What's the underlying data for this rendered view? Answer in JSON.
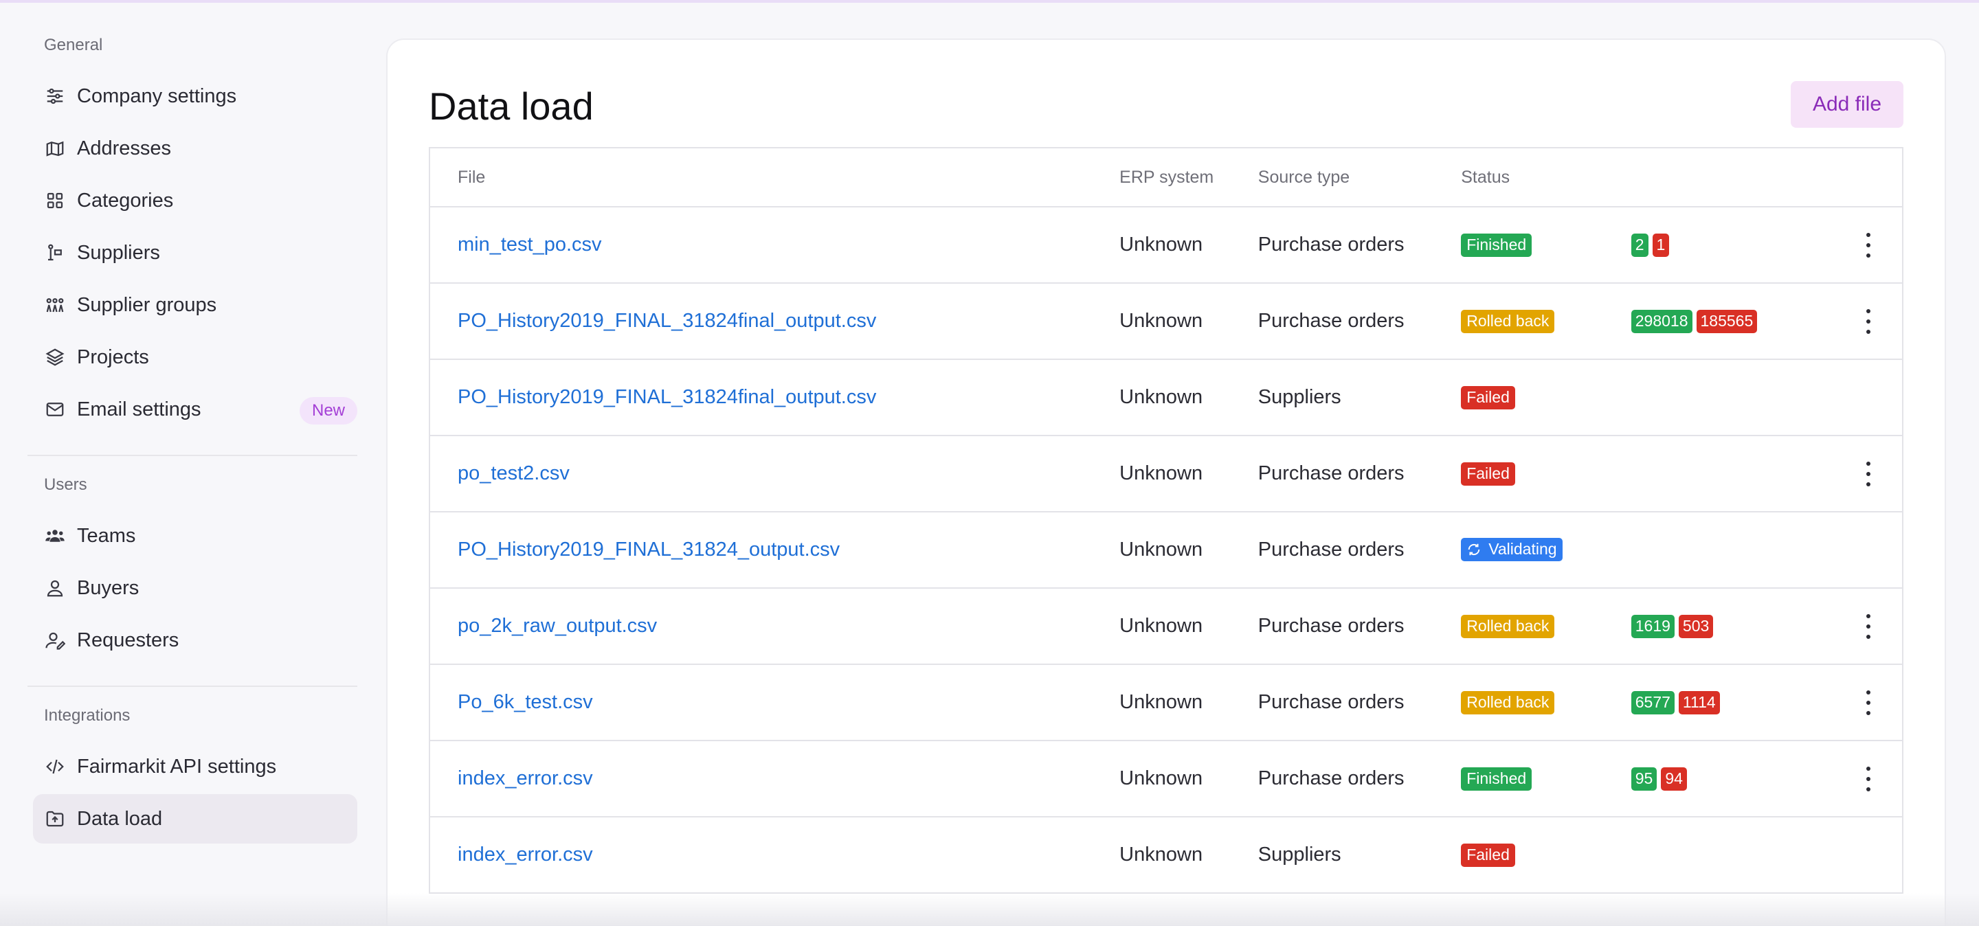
{
  "sidebar": {
    "sections": [
      {
        "title": "General",
        "items": [
          {
            "label": "Company settings",
            "icon": "sliders-icon"
          },
          {
            "label": "Addresses",
            "icon": "map-pin-icon"
          },
          {
            "label": "Categories",
            "icon": "grid-icon"
          },
          {
            "label": "Suppliers",
            "icon": "supplier-icon"
          },
          {
            "label": "Supplier groups",
            "icon": "group-icon"
          },
          {
            "label": "Projects",
            "icon": "layers-icon"
          },
          {
            "label": "Email settings",
            "icon": "mail-icon",
            "badge": "New"
          }
        ]
      },
      {
        "title": "Users",
        "items": [
          {
            "label": "Teams",
            "icon": "team-icon"
          },
          {
            "label": "Buyers",
            "icon": "user-icon"
          },
          {
            "label": "Requesters",
            "icon": "user-edit-icon"
          }
        ]
      },
      {
        "title": "Integrations",
        "items": [
          {
            "label": "Fairmarkit API settings",
            "icon": "code-icon"
          },
          {
            "label": "Data load",
            "icon": "upload-icon",
            "active": true
          }
        ]
      }
    ]
  },
  "main": {
    "title": "Data load",
    "add_file_label": "Add file",
    "columns": {
      "file": "File",
      "erp": "ERP system",
      "source": "Source type",
      "status": "Status"
    },
    "rows": [
      {
        "file": "min_test_po.csv",
        "erp": "Unknown",
        "source": "Purchase orders",
        "status": "Finished",
        "status_color": "green",
        "success": "2",
        "error": "1",
        "menu": true
      },
      {
        "file": "PO_History2019_FINAL_31824final_output.csv",
        "erp": "Unknown",
        "source": "Purchase orders",
        "status": "Rolled back",
        "status_color": "amber",
        "success": "298018",
        "error": "185565",
        "menu": true
      },
      {
        "file": "PO_History2019_FINAL_31824final_output.csv",
        "erp": "Unknown",
        "source": "Suppliers",
        "status": "Failed",
        "status_color": "red",
        "success": "",
        "error": "",
        "menu": false
      },
      {
        "file": "po_test2.csv",
        "erp": "Unknown",
        "source": "Purchase orders",
        "status": "Failed",
        "status_color": "red",
        "success": "",
        "error": "",
        "menu": true
      },
      {
        "file": "PO_History2019_FINAL_31824_output.csv",
        "erp": "Unknown",
        "source": "Purchase orders",
        "status": "Validating",
        "status_color": "blue",
        "success": "",
        "error": "",
        "menu": false
      },
      {
        "file": "po_2k_raw_output.csv",
        "erp": "Unknown",
        "source": "Purchase orders",
        "status": "Rolled back",
        "status_color": "amber",
        "success": "1619",
        "error": "503",
        "menu": true
      },
      {
        "file": "Po_6k_test.csv",
        "erp": "Unknown",
        "source": "Purchase orders",
        "status": "Rolled back",
        "status_color": "amber",
        "success": "6577",
        "error": "1114",
        "menu": true
      },
      {
        "file": "index_error.csv",
        "erp": "Unknown",
        "source": "Purchase orders",
        "status": "Finished",
        "status_color": "green",
        "success": "95",
        "error": "94",
        "menu": true
      },
      {
        "file": "index_error.csv",
        "erp": "Unknown",
        "source": "Suppliers",
        "status": "Failed",
        "status_color": "red",
        "success": "",
        "error": "",
        "menu": false
      }
    ]
  },
  "colors": {
    "accent": "#8a2bb8",
    "link": "#1f6fd6",
    "success": "#24a854",
    "error": "#d93025",
    "warning": "#e2a400",
    "info": "#2f7cf0"
  }
}
